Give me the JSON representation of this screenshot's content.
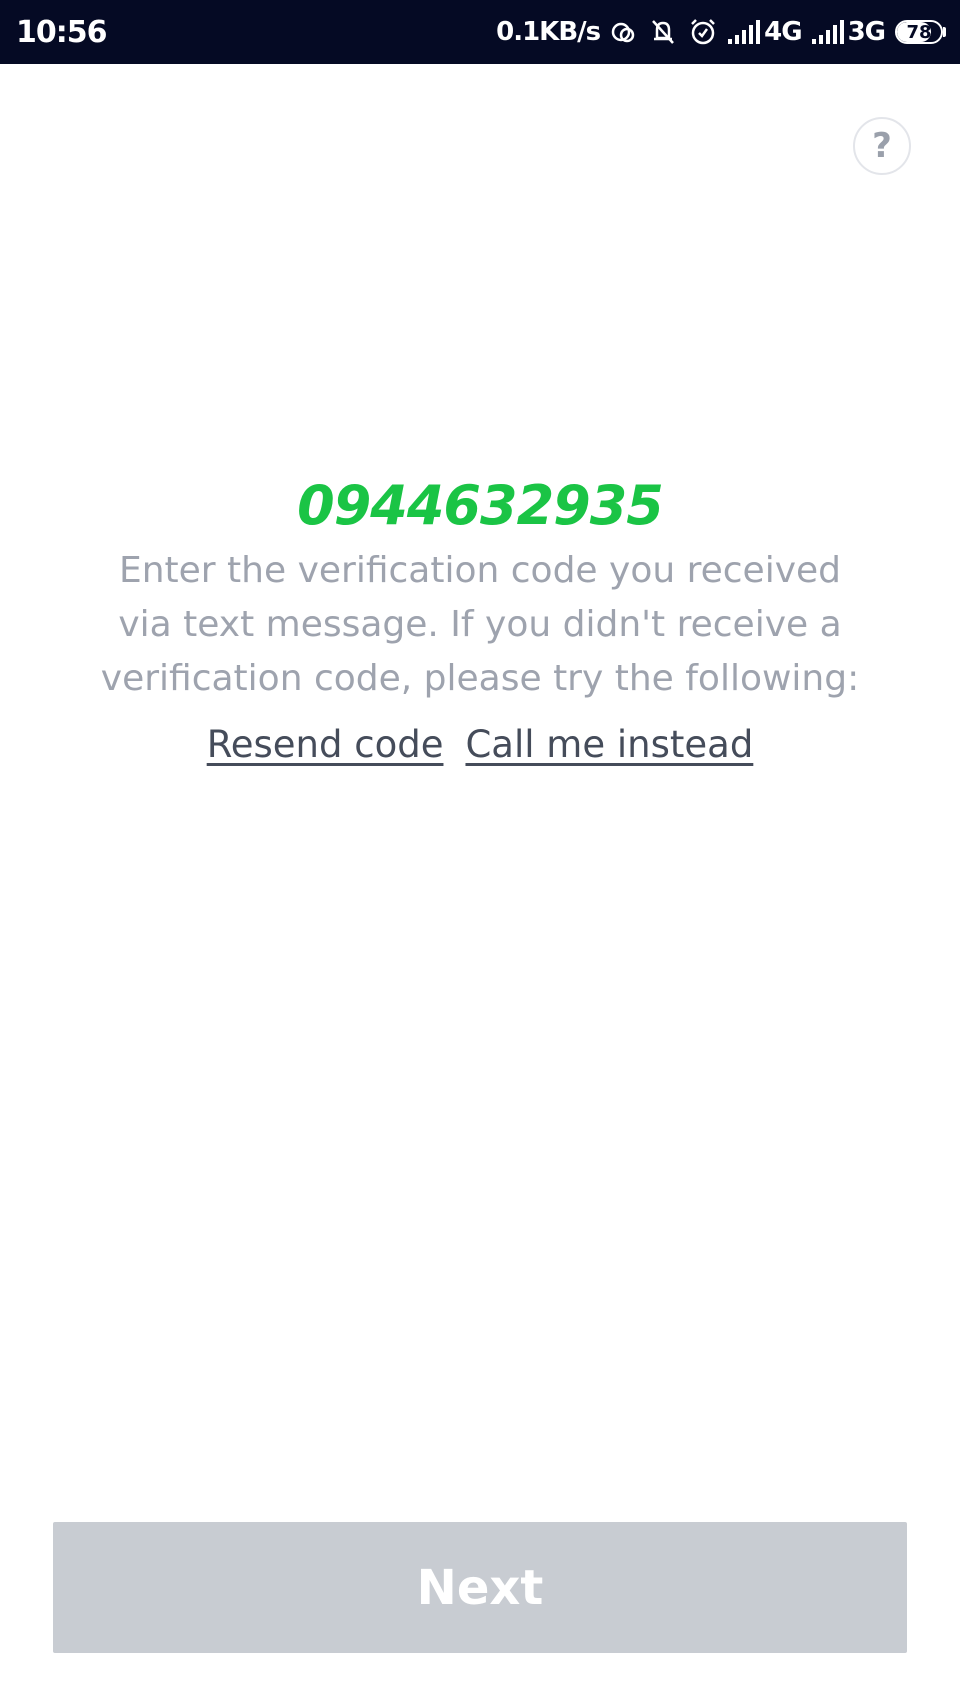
{
  "status_bar": {
    "time": "10:56",
    "net_speed": "0.1KB/s",
    "signal1_label": "4G",
    "signal2_label": "3G",
    "battery_level": "78",
    "battery_fraction": 0.78,
    "icons": [
      "hotspot-icon",
      "mute-icon",
      "alarm-icon",
      "signal-icon",
      "signal-icon",
      "battery-icon"
    ]
  },
  "help_button": {
    "label": "?"
  },
  "main": {
    "phone_number": "0944632935",
    "instructions": "Enter the verification code you received via text message. If you didn't receive a verification code, please try the following:",
    "resend_label": "Resend code",
    "call_label": "Call me instead"
  },
  "footer": {
    "next_label": "Next",
    "next_enabled": false
  },
  "colors": {
    "status_bar_bg": "#050a24",
    "phone_green": "#1ac445",
    "text_gray": "#9ea3ae",
    "link_dark": "#454c5a",
    "button_disabled": "#c8ccd2"
  }
}
